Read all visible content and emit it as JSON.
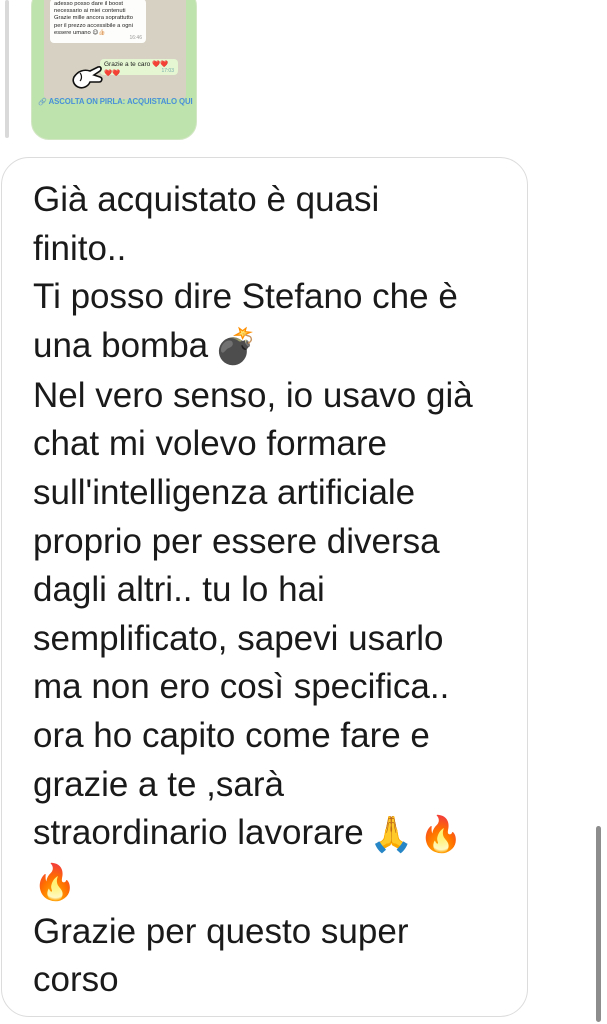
{
  "preview": {
    "incoming_text": "adesso posso dare il boost necessario ai miei contenuti Grazie mille ancora soprattutto per il prezzo accessibile a ogni essere umano 😉👍🏻",
    "incoming_time": "16:46",
    "outgoing_text": "Grazie a te caro ❤️❤️❤️❤️",
    "outgoing_time": "17:03",
    "link_text": "ASCOLTA ON PIRLA: ACQUISTALO QUI"
  },
  "message": {
    "line1": "Già acquistato è quasi\nfinito..\nTi posso dire Stefano che è\nuna bomba",
    "emoji_bomb": "💣",
    "line2": "\nNel vero senso, io usavo già\nchat   mi volevo formare\nsull'intelligenza artificiale\nproprio per essere diversa\ndagli altri.. tu lo hai\nsemplificato, sapevi usarlo\nma non ero così specifica..\nora ho capito come fare e\ngrazie a te ,sarà\nstraordinario lavorare",
    "emoji_pray": "🙏",
    "emoji_fire1": "🔥",
    "emoji_fire2": "🔥",
    "line3": "\nGrazie per questo super\ncorso"
  },
  "colors": {
    "preview_bg": "#bfe3ad",
    "link": "#4a8fd9",
    "bubble_border": "#dcdcdc",
    "text": "#1a1a1a"
  }
}
